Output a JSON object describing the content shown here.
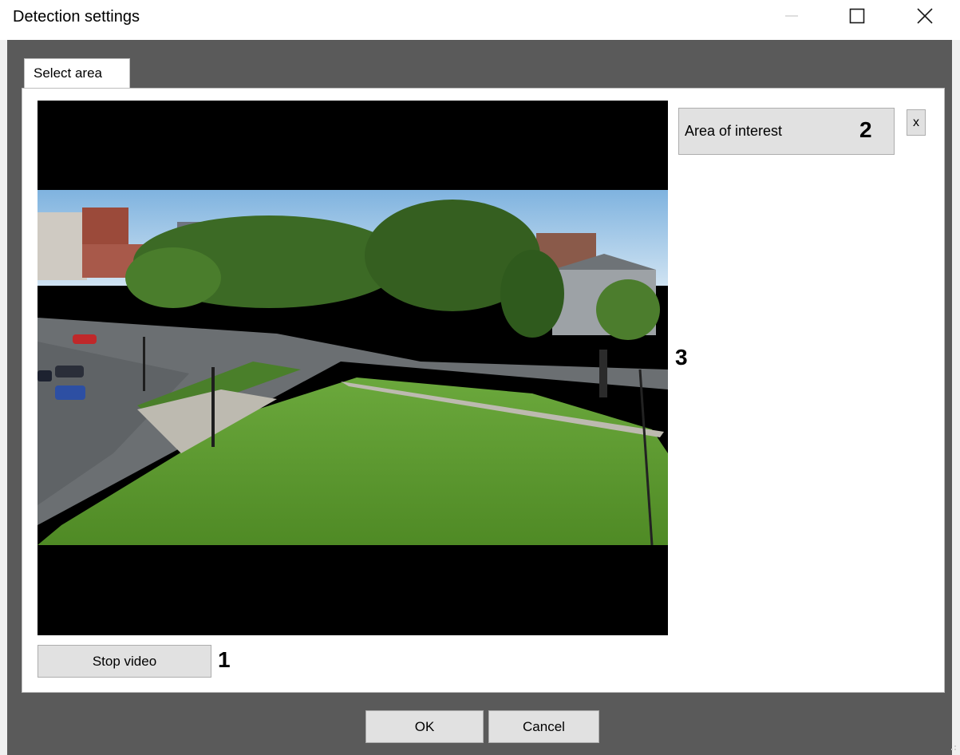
{
  "window": {
    "title": "Detection settings",
    "controls": {
      "minimize": "minimize-icon",
      "maximize": "maximize-icon",
      "close": "close-icon"
    }
  },
  "tabs": [
    {
      "label": "Select area",
      "active": true
    }
  ],
  "video": {
    "content": "camera view of a campus: parking lot, lawn, trees and buildings"
  },
  "buttons": {
    "stop_video": "Stop video",
    "area_of_interest": "Area of interest",
    "remove_area": "x",
    "ok": "OK",
    "cancel": "Cancel"
  },
  "callouts": {
    "c1": "1",
    "c2": "2",
    "c3": "3"
  },
  "colors": {
    "dialog_background": "#5a5a5a",
    "panel_background": "#ffffff",
    "button_face": "#e1e1e1",
    "button_border": "#adadad",
    "video_background": "#000000"
  }
}
